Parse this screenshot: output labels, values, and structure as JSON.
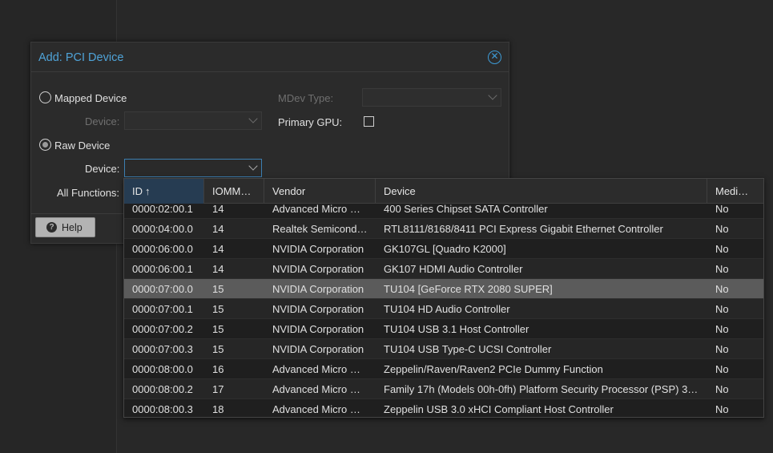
{
  "dialog": {
    "title": "Add: PCI Device",
    "mapped_device_label": "Mapped Device",
    "mapped_device_field_label": "Device:",
    "raw_device_label": "Raw Device",
    "raw_device_field_label": "Device:",
    "all_functions_label": "All Functions:",
    "mdev_type_label": "MDev Type:",
    "primary_gpu_label": "Primary GPU:",
    "help_label": "Help",
    "selected_mode": "raw"
  },
  "grid": {
    "columns": {
      "id": "ID",
      "iommu": "IOMM…",
      "vendor": "Vendor",
      "device": "Device",
      "mediated": "Medi…"
    },
    "sort": {
      "column": "id",
      "direction": "asc"
    },
    "rows": [
      {
        "id": "0000:02:00.1",
        "iommu": "14",
        "vendor": "Advanced Micro …",
        "device": "400 Series Chipset SATA Controller",
        "mediated": "No"
      },
      {
        "id": "0000:04:00.0",
        "iommu": "14",
        "vendor": "Realtek Semicond…",
        "device": "RTL8111/8168/8411 PCI Express Gigabit Ethernet Controller",
        "mediated": "No"
      },
      {
        "id": "0000:06:00.0",
        "iommu": "14",
        "vendor": "NVIDIA Corporation",
        "device": "GK107GL [Quadro K2000]",
        "mediated": "No"
      },
      {
        "id": "0000:06:00.1",
        "iommu": "14",
        "vendor": "NVIDIA Corporation",
        "device": "GK107 HDMI Audio Controller",
        "mediated": "No"
      },
      {
        "id": "0000:07:00.0",
        "iommu": "15",
        "vendor": "NVIDIA Corporation",
        "device": "TU104 [GeForce RTX 2080 SUPER]",
        "mediated": "No",
        "selected": true
      },
      {
        "id": "0000:07:00.1",
        "iommu": "15",
        "vendor": "NVIDIA Corporation",
        "device": "TU104 HD Audio Controller",
        "mediated": "No"
      },
      {
        "id": "0000:07:00.2",
        "iommu": "15",
        "vendor": "NVIDIA Corporation",
        "device": "TU104 USB 3.1 Host Controller",
        "mediated": "No"
      },
      {
        "id": "0000:07:00.3",
        "iommu": "15",
        "vendor": "NVIDIA Corporation",
        "device": "TU104 USB Type-C UCSI Controller",
        "mediated": "No"
      },
      {
        "id": "0000:08:00.0",
        "iommu": "16",
        "vendor": "Advanced Micro …",
        "device": "Zeppelin/Raven/Raven2 PCIe Dummy Function",
        "mediated": "No"
      },
      {
        "id": "0000:08:00.2",
        "iommu": "17",
        "vendor": "Advanced Micro …",
        "device": "Family 17h (Models 00h-0fh) Platform Security Processor (PSP) 3…",
        "mediated": "No"
      },
      {
        "id": "0000:08:00.3",
        "iommu": "18",
        "vendor": "Advanced Micro …",
        "device": "Zeppelin USB 3.0 xHCI Compliant Host Controller",
        "mediated": "No"
      }
    ]
  }
}
